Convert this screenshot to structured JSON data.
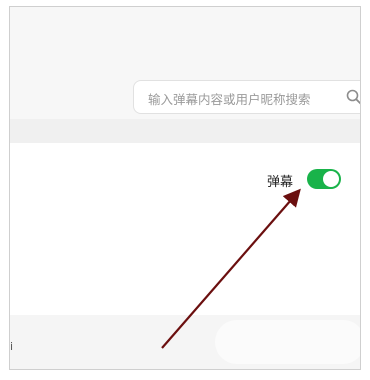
{
  "search": {
    "placeholder": "输入弹幕内容或用户昵称搜索",
    "icon": "search-icon"
  },
  "danmaku": {
    "label": "弹幕",
    "toggle_on": true,
    "toggle_color": "#19b34a"
  },
  "annotation": {
    "arrow_color": "#6b0f0f"
  },
  "edge_text": "i"
}
